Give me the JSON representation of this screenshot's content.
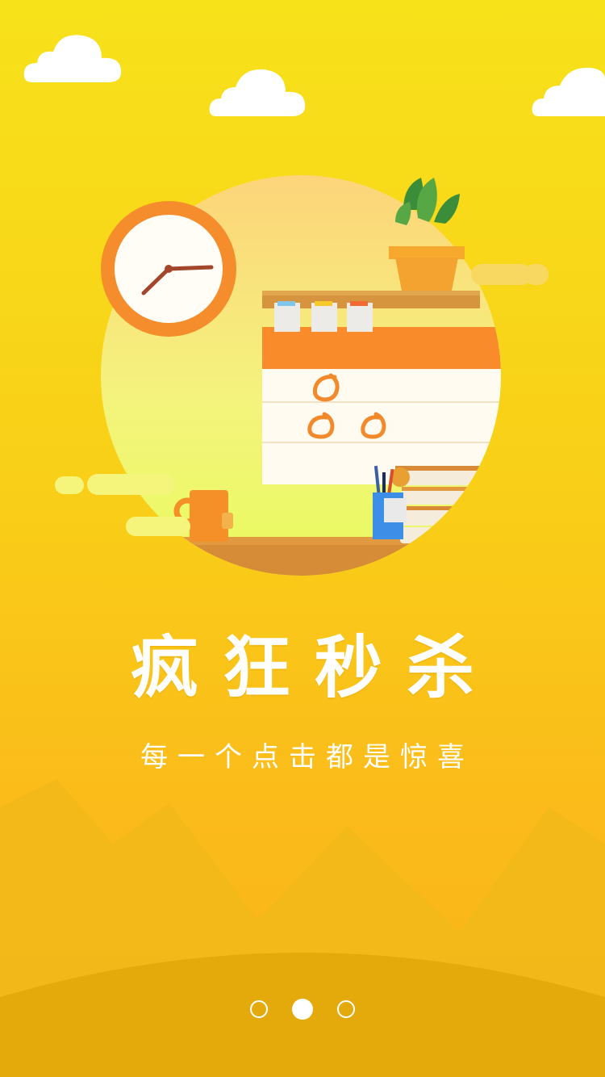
{
  "screen": {
    "title": "疯狂秒杀",
    "subtitle": "每一个点击都是惊喜",
    "current_page": 2,
    "total_pages": 3
  },
  "illustration": {
    "icons": [
      "cloud-icon",
      "clock-icon",
      "plant-pot-icon",
      "calendar-icon",
      "mug-icon",
      "pencil-cup-icon",
      "books-icon"
    ]
  },
  "pagination": {
    "dots": [
      {
        "label": "page-1",
        "active": false
      },
      {
        "label": "page-2",
        "active": true
      },
      {
        "label": "page-3",
        "active": false
      }
    ]
  },
  "colors": {
    "background_top": "#f7e21a",
    "background_bottom": "#f7b515",
    "accent_orange": "#f98b2b",
    "text": "#ffffff"
  }
}
